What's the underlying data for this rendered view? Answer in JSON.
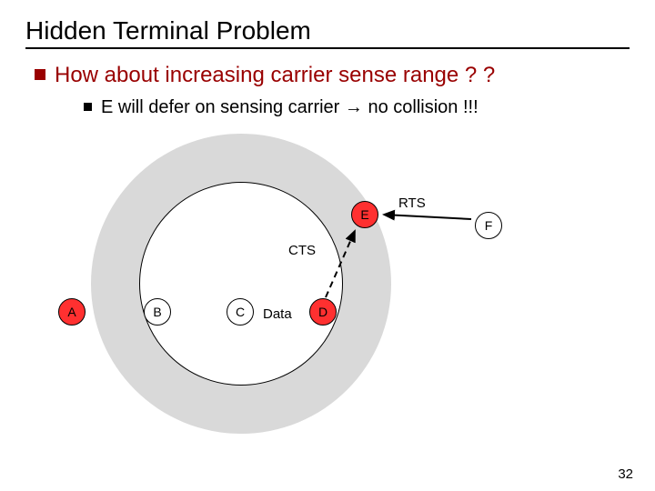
{
  "title": "Hidden Terminal Problem",
  "bullet1": "How about increasing carrier sense range ? ?",
  "bullet2_pre": "E will defer on sensing carrier ",
  "bullet2_arrow": "→",
  "bullet2_post": " no collision !!!",
  "nodes": {
    "A": "A",
    "B": "B",
    "C": "C",
    "D": "D",
    "E": "E",
    "F": "F"
  },
  "labels": {
    "CTS": "CTS",
    "Data": "Data",
    "RTS": "RTS"
  },
  "page_number": "32"
}
